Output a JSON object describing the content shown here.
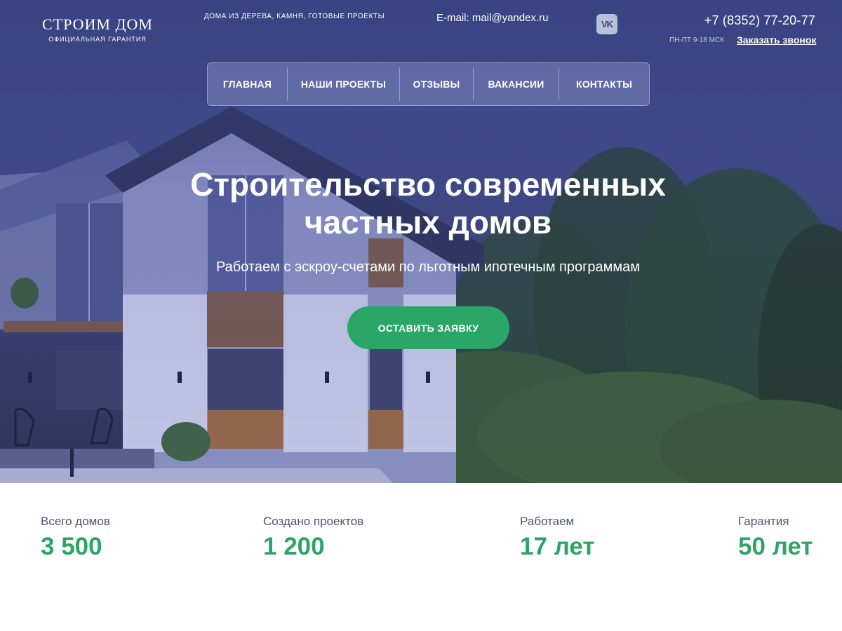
{
  "header": {
    "logo_title": "СТРОИМ ДОМ",
    "logo_subtitle": "ОФИЦИАЛЬНАЯ ГАРАНТИЯ",
    "tagline": "ДОМА ИЗ ДЕРЕВА, КАМНЯ, ГОТОВЫЕ ПРОЕКТЫ",
    "email": "E-mail: mail@yandex.ru",
    "vk_label": "VK",
    "vk_icon": "vk-icon",
    "phone": "+7 (8352) 77-20-77",
    "hours": "ПН-ПТ 9-18 МСК",
    "callback_label": "Заказать звонок"
  },
  "nav": {
    "items": [
      {
        "label": "ГЛАВНАЯ"
      },
      {
        "label": "НАШИ ПРОЕКТЫ"
      },
      {
        "label": "ОТЗЫВЫ"
      },
      {
        "label": "ВАКАНСИИ"
      },
      {
        "label": "КОНТАКТЫ"
      }
    ]
  },
  "hero": {
    "title_line1": "Строительство современных",
    "title_line2": "частных домов",
    "subtitle": "Работаем с эскроу-счетами по льготным ипотечным программам",
    "cta_label": "ОСТАВИТЬ ЗАЯВКУ"
  },
  "stats": [
    {
      "label": "Всего домов",
      "value": "3 500"
    },
    {
      "label": "Создано проектов",
      "value": "1 200"
    },
    {
      "label": "Работаем",
      "value": "17 лет"
    },
    {
      "label": "Гарантия",
      "value": "50 лет"
    }
  ],
  "colors": {
    "accent_green": "#2aa766",
    "hero_blue": "#3c4886",
    "stat_label": "#4a5573"
  }
}
